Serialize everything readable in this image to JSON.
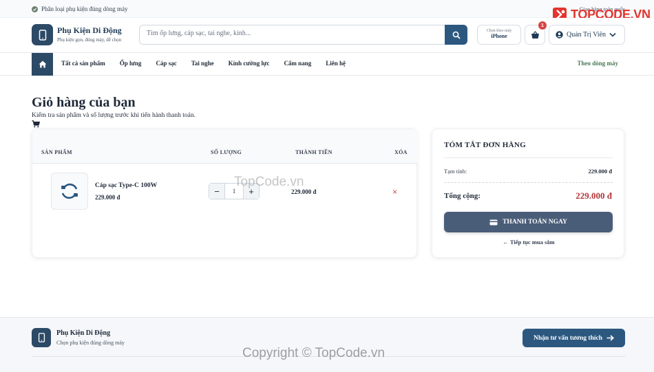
{
  "topbar": {
    "left_text": "Phân loại phụ kiện đúng dòng máy",
    "right_text": "Giao hàng toàn quốc"
  },
  "watermark_logo": {
    "text": "TOPCODE.VN"
  },
  "header": {
    "brand_name": "Phụ Kiện Di Động",
    "brand_sub": "Phụ kiện gọn, đúng máy, dễ chọn",
    "search_placeholder": "Tìm ốp lưng, cáp sạc, tai nghe, kính...",
    "device_label": "Chọn theo máy",
    "device_value": "iPhone",
    "cart_count": "1",
    "user_name": "Quản Trị Viên"
  },
  "nav": {
    "items": [
      "Tất cả sản phẩm",
      "Ốp lưng",
      "Cáp sạc",
      "Tai nghe",
      "Kính cường lực",
      "Cẩm nang",
      "Liên hệ"
    ],
    "follow_label": "Theo dòng máy"
  },
  "page": {
    "title": "Giỏ hàng của bạn",
    "subtitle": "Kiểm tra sản phẩm và số lượng trước khi tiến hành thanh toán."
  },
  "cart": {
    "columns": [
      "SẢN PHẨM",
      "SỐ LƯỢNG",
      "THÀNH TIỀN",
      "XÓA"
    ],
    "items": [
      {
        "name": "Cáp sạc Type-C 100W",
        "price": "229.000 đ",
        "quantity": "1",
        "line_total": "229.000 đ",
        "remove": "×"
      }
    ],
    "minus": "−",
    "plus": "+"
  },
  "summary": {
    "title": "TÓM TẮT ĐƠN HÀNG",
    "subtotal_label": "Tạm tính:",
    "subtotal_value": "229.000 đ",
    "total_label": "Tổng cộng:",
    "total_value": "229.000 đ",
    "checkout_label": "THANH TOÁN NGAY",
    "continue_label": "← Tiếp tục mua sắm"
  },
  "footer": {
    "brand_name": "Phụ Kiện Di Động",
    "brand_sub": "Chọn phụ kiện đúng dòng máy",
    "cta_label": "Nhận tư vấn tương thích"
  },
  "watermarks": {
    "center": "TopCode.vn",
    "bottom": "Copyright © TopCode.vn"
  },
  "colors": {
    "primary": "#2c4a66",
    "accent": "#2c5880",
    "danger": "#d64545",
    "total": "#b3363a",
    "follow": "#4a7a56"
  }
}
